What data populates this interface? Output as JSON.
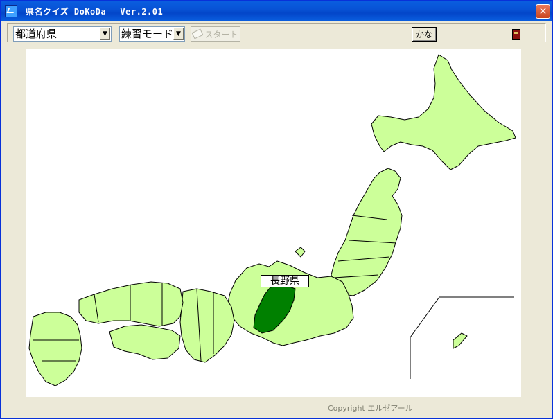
{
  "window": {
    "title": "県名クイズ DoKoDa　 Ver.2.01",
    "close_glyph": "✕"
  },
  "toolbar": {
    "category_select": {
      "value": "都道府県",
      "arrow": "▼"
    },
    "mode_select": {
      "value": "練習モード",
      "arrow": "▼"
    },
    "start_button_label": "スタート",
    "kana_button_label": "かな"
  },
  "map": {
    "highlighted_prefecture": "長野県",
    "colors": {
      "land": "#ccff99",
      "highlight": "#008000",
      "border": "#000000"
    }
  },
  "footer": {
    "copyright": "Copyright エルゼアール"
  },
  "icons": [
    "app-icon",
    "close-icon",
    "eraser-icon",
    "book-icon",
    "dropdown-arrow-icon"
  ]
}
